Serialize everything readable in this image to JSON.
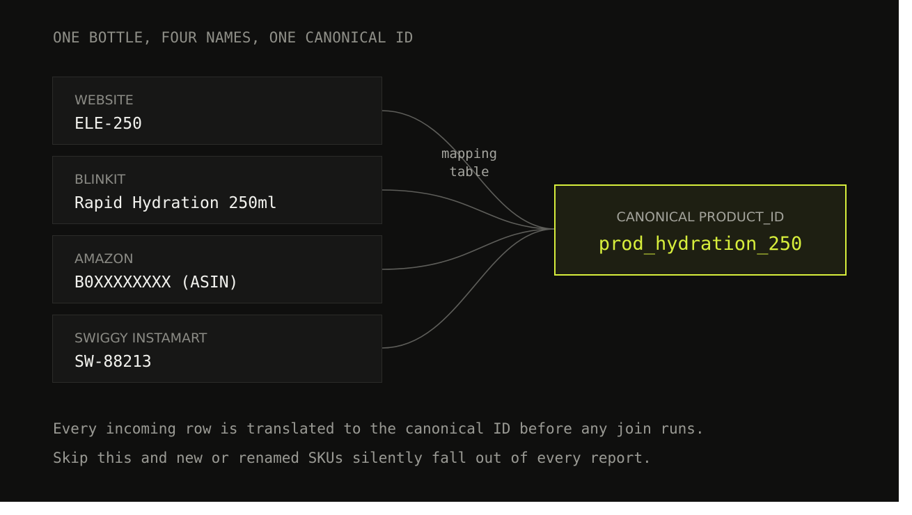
{
  "title": "ONE BOTTLE, FOUR NAMES, ONE CANONICAL ID",
  "sources": [
    {
      "channel": "WEBSITE",
      "sku": "ELE-250"
    },
    {
      "channel": "BLINKIT",
      "sku": "Rapid Hydration 250ml"
    },
    {
      "channel": "AMAZON",
      "sku": "B0XXXXXXXX (ASIN)"
    },
    {
      "channel": "SWIGGY INSTAMART",
      "sku": "SW-88213"
    }
  ],
  "connector_label": {
    "line1": "mapping",
    "line2": "table"
  },
  "canonical": {
    "label": "CANONICAL PRODUCT_ID",
    "value": "prod_hydration_250"
  },
  "caption": {
    "line1": "Every incoming row is translated to the canonical ID before any join runs.",
    "line2": "Skip this and new or renamed SKUs silently fall out of every report."
  },
  "colors": {
    "background": "#0f0f0e",
    "card": "#171716",
    "accent": "#d7ee3c",
    "connector": "#5e5e5a"
  }
}
